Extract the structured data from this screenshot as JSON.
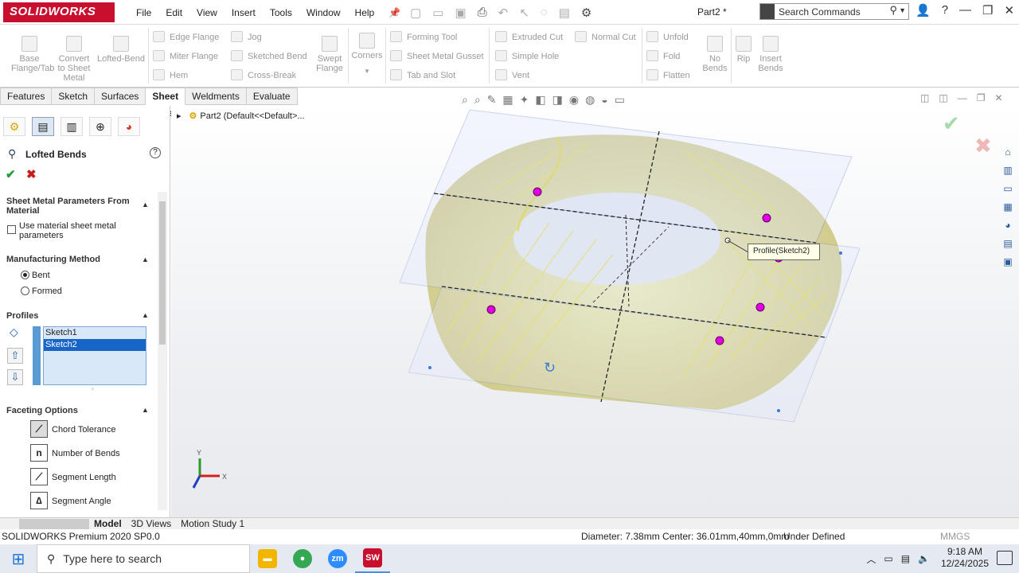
{
  "app": {
    "brand": "SOLIDWORKS",
    "doc_title": "Part2 *"
  },
  "menus": [
    "File",
    "Edit",
    "View",
    "Insert",
    "Tools",
    "Window",
    "Help"
  ],
  "search": {
    "placeholder": "Search Commands"
  },
  "ribbon": {
    "big": [
      {
        "label": "Base\nFlange/Tab"
      },
      {
        "label": "Convert\nto Sheet\nMetal"
      },
      {
        "label": "Lofted-Bend"
      },
      {
        "label": "Swept\nFlange"
      },
      {
        "label": "Corners"
      },
      {
        "label": "No\nBends"
      },
      {
        "label": "Rip"
      },
      {
        "label": "Insert\nBends"
      }
    ],
    "small": [
      "Edge Flange",
      "Miter Flange",
      "Hem",
      "Jog",
      "Sketched Bend",
      "Cross-Break",
      "Forming Tool",
      "Sheet Metal Gusset",
      "Tab and Slot",
      "Extruded Cut",
      "Simple Hole",
      "Vent",
      "Normal Cut",
      "Unfold",
      "Fold",
      "Flatten"
    ]
  },
  "cm_tabs": [
    "Features",
    "Sketch",
    "Surfaces",
    "Sheet Metal",
    "Weldments",
    "Evaluate"
  ],
  "cm_active": "Sheet Metal",
  "pm": {
    "title": "Lofted Bends",
    "help": "?",
    "group1": "Sheet Metal Parameters From Material",
    "use_material": "Use material sheet metal parameters",
    "group2": "Manufacturing Method",
    "bent": "Bent",
    "formed": "Formed",
    "group3": "Profiles",
    "profiles": [
      "Sketch1",
      "Sketch2"
    ],
    "group4": "Faceting Options",
    "faceting": [
      {
        "label": "Chord Tolerance",
        "glyph": "⟋"
      },
      {
        "label": "Number of Bends",
        "glyph": "n"
      },
      {
        "label": "Segment Length",
        "glyph": "⟋"
      },
      {
        "label": "Segment Angle",
        "glyph": "∆"
      }
    ]
  },
  "tree": {
    "node": "Part2  (Default<<Default>..."
  },
  "viewport": {
    "tooltip": "Profile(Sketch2)",
    "triad_y": "Y",
    "triad_x": "X"
  },
  "bottom_tabs": [
    "Model",
    "3D Views",
    "Motion Study 1"
  ],
  "status": {
    "product": "SOLIDWORKS Premium 2020 SP0.0",
    "measure": "Diameter: 7.38mm  Center: 36.01mm,40mm,0mm",
    "definition": "Under Defined",
    "units": "MMGS"
  },
  "taskbar": {
    "search": "Type here to search",
    "time": "9:18 AM",
    "date": "12/24/2025",
    "apps": [
      {
        "name": "file-explorer",
        "color": "#f2b600",
        "glyph": "▬"
      },
      {
        "name": "chrome",
        "color": "#34a853",
        "glyph": "●"
      },
      {
        "name": "zoom",
        "color": "#2d8cff",
        "glyph": "zm"
      },
      {
        "name": "solidworks",
        "color": "#c8102e",
        "glyph": "SW"
      }
    ]
  },
  "colors": {
    "accent": "#c8102e",
    "selection": "#1765c6",
    "part_fill": "#e4e06a",
    "sketch_point": "#e000e0"
  }
}
